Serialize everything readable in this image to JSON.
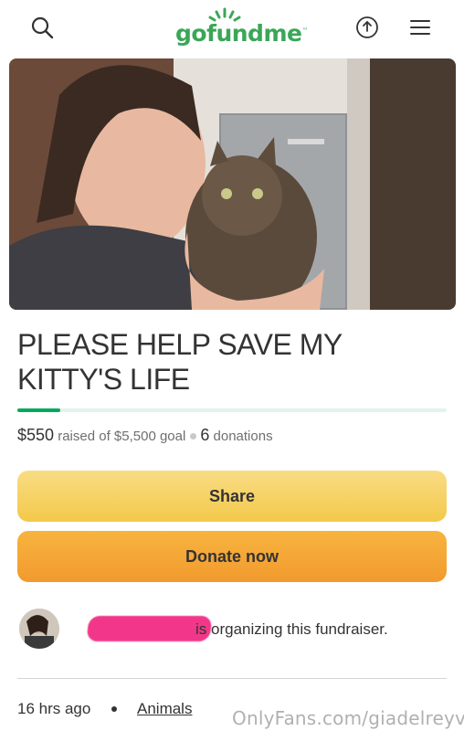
{
  "header": {
    "logo": "gofundme",
    "logo_tm": "™",
    "icons": [
      "search-icon",
      "share-icon",
      "menu-icon"
    ]
  },
  "campaign": {
    "title": "PLEASE HELP SAVE MY KITTY'S LIFE",
    "raised": "$550",
    "raised_suffix": "raised of $5,500 goal",
    "donations": "6 donations",
    "progress_fraction": 0.1
  },
  "buttons": {
    "share": "Share",
    "donate": "Donate now"
  },
  "organizer": {
    "text": "is organizing this fundraiser."
  },
  "footer": {
    "time": "16 hrs ago",
    "category": "Animals"
  },
  "watermark": "OnlyFans.com/giadelreyvip",
  "colors": {
    "brand": "#3aa757",
    "progress": "#02a95c",
    "share_button": "#f3c94a",
    "donate_button": "#f29a2e",
    "redaction": "#f2378a"
  }
}
